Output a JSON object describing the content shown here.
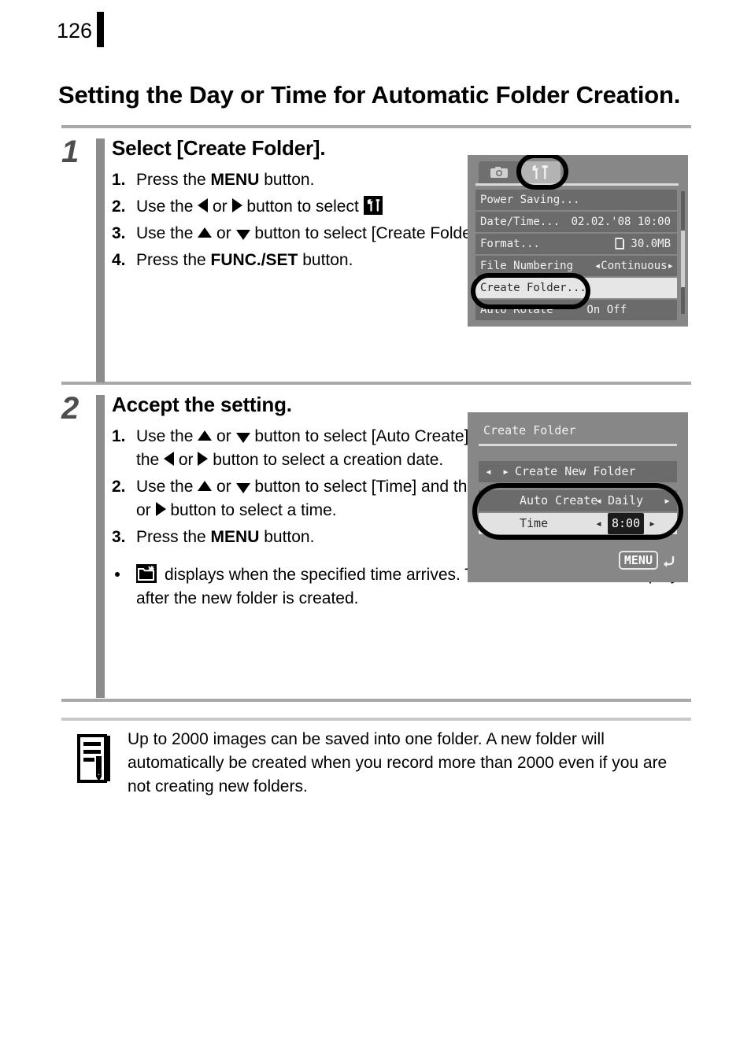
{
  "page": {
    "number": "126",
    "title": "Setting the Day or Time for Automatic Folder Creation."
  },
  "steps": [
    {
      "number": "1",
      "title": "Select [Create Folder].",
      "items": [
        {
          "marker": "1.",
          "text_before": "Press the ",
          "bold": "MENU",
          "text_after": " button."
        },
        {
          "marker": "2.",
          "text_a": "Use the ",
          "text_b": " or ",
          "text_c": " button to select ",
          "text_d": " menu."
        },
        {
          "marker": "3.",
          "text_a": "Use the ",
          "text_b": " or ",
          "text_c": " button to select [Create Folder]."
        },
        {
          "marker": "4.",
          "text_before": "Press the ",
          "bold": "FUNC./SET",
          "text_after": " button."
        }
      ]
    },
    {
      "number": "2",
      "title": "Accept the setting.",
      "items": [
        {
          "marker": "1.",
          "text_a": "Use the ",
          "text_b": " or ",
          "text_c": " button to select [Auto Create] and the ",
          "text_d": " or ",
          "text_e": " button to select a creation date."
        },
        {
          "marker": "2.",
          "text_a": "Use the ",
          "text_b": " or ",
          "text_c": " button to select [Time] and the ",
          "text_d": " or ",
          "text_e": " button to select a time."
        },
        {
          "marker": "3.",
          "text_before": "Press the ",
          "bold": "MENU",
          "text_after": " button."
        }
      ],
      "bullet": "displays when the specified time arrives. The icon will cease to display after the new folder is created."
    }
  ],
  "screenshot_setup_menu": {
    "tabs": [
      {
        "icon": "camera-icon",
        "state": "inactive"
      },
      {
        "icon": "tools-icon",
        "state": "active"
      }
    ],
    "rows": [
      {
        "label": "Power Saving...",
        "value": "",
        "selected": false,
        "arrows": false
      },
      {
        "label": "Date/Time...",
        "value": "02.02.'08 10:00",
        "selected": false,
        "arrows": false
      },
      {
        "label": "Format...",
        "value": "30.0MB",
        "icon": "sd-card-icon",
        "selected": false,
        "arrows": false
      },
      {
        "label": "File Numbering",
        "value": "Continuous",
        "selected": false,
        "arrows": true
      },
      {
        "label": "Create Folder...",
        "value": "",
        "selected": true,
        "arrows": false
      },
      {
        "label": "Auto Rotate",
        "value": "On Off",
        "selected": false,
        "arrows": false
      }
    ]
  },
  "screenshot_create_folder": {
    "title": "Create Folder",
    "rows": [
      {
        "label": "Create New Folder",
        "value": "",
        "style": "dark",
        "arrows": true
      },
      {
        "label": "Auto Create",
        "value": "Daily",
        "style": "dark",
        "arrows": true
      },
      {
        "label": "Time",
        "value": "8:00",
        "style": "light",
        "arrows": true,
        "chip": true
      }
    ],
    "menu_chip": "MENU",
    "back_icon": "return-arrow-icon"
  },
  "note": {
    "icon": "notepad-pencil-icon",
    "text": "Up to 2000 images can be saved into one folder. A new folder will automatically be created when you record more than 2000 even if you are not creating new folders."
  },
  "colors": {
    "rule": "#a8a8a8",
    "rule_light": "#c9c9c9",
    "step_bar": "#8c8c8c",
    "step_number": "#4d4d4d",
    "shot_bg": "#878787",
    "row_bg": "#6b6b6b",
    "row_selected_bg": "#e6e6e6"
  }
}
